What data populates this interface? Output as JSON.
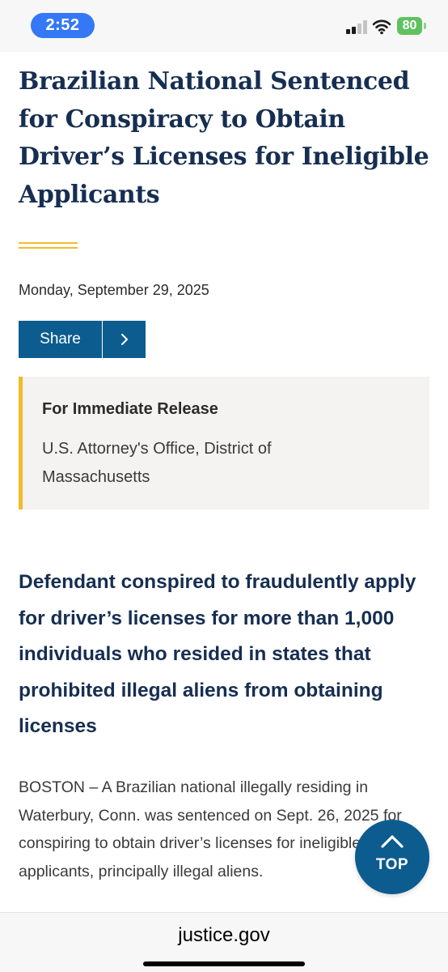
{
  "status_bar": {
    "time": "2:52",
    "battery": "80"
  },
  "article": {
    "headline": "Brazilian National Sentenced for Conspiracy to Obtain Driver’s Licenses for Ineligible Applicants",
    "date": "Monday, September 29, 2025",
    "share_label": "Share",
    "release": {
      "title": "For Immediate Release",
      "office": "U.S. Attorney's Office, District of Massachusetts"
    },
    "subheadline": "Defendant conspired to fraudulently apply for driver’s licenses for more than 1,000 individuals who resided in states that prohibited illegal aliens from obtaining licenses",
    "body": "BOSTON – A Brazilian national illegally residing in Waterbury, Conn. was sentenced on Sept. 26, 2025 for conspiring to obtain driver’s licenses for ineligible applicants, principally illegal aliens."
  },
  "top_button": {
    "label": "TOP"
  },
  "browser": {
    "domain": "justice.gov"
  },
  "colors": {
    "brand_navy": "#162e51",
    "brand_blue": "#0d5c8f",
    "accent_gold": "#f2bb2a",
    "time_pill": "#3478f6",
    "battery_green": "#5fc160"
  },
  "icons": [
    "signal-icon",
    "wifi-icon",
    "battery-icon",
    "chevron-right-icon",
    "chevron-up-icon"
  ]
}
